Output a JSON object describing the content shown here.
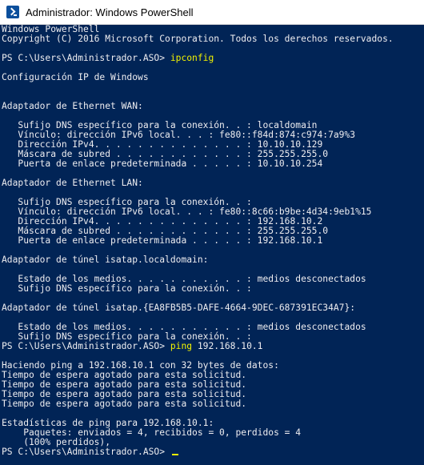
{
  "window": {
    "title": "Administrador: Windows PowerShell"
  },
  "console": {
    "l1": "Windows PowerShell",
    "l2": "Copyright (C) 2016 Microsoft Corporation. Todos los derechos reservados.",
    "prompt": "PS C:\\Users\\Administrador.ASO> ",
    "cmd1": "ipconfig",
    "l5": "Configuración IP de Windows",
    "l8": "Adaptador de Ethernet WAN:",
    "l10": "   Sufijo DNS específico para la conexión. . : localdomain",
    "l11": "   Vínculo: dirección IPv6 local. . . : fe80::f84d:874:c974:7a9%3",
    "l12": "   Dirección IPv4. . . . . . . . . . . . . . : 10.10.10.129",
    "l13": "   Máscara de subred . . . . . . . . . . . . : 255.255.255.0",
    "l14": "   Puerta de enlace predeterminada . . . . . : 10.10.10.254",
    "l16": "Adaptador de Ethernet LAN:",
    "l18": "   Sufijo DNS específico para la conexión. . :",
    "l19": "   Vínculo: dirección IPv6 local. . . : fe80::8c66:b9be:4d34:9eb1%15",
    "l20": "   Dirección IPv4. . . . . . . . . . . . . . : 192.168.10.2",
    "l21": "   Máscara de subred . . . . . . . . . . . . : 255.255.255.0",
    "l22": "   Puerta de enlace predeterminada . . . . . : 192.168.10.1",
    "l24": "Adaptador de túnel isatap.localdomain:",
    "l26": "   Estado de los medios. . . . . . . . . . . : medios desconectados",
    "l27": "   Sufijo DNS específico para la conexión. . :",
    "l29": "Adaptador de túnel isatap.{EA8FB5B5-DAFE-4664-9DEC-687391EC34A7}:",
    "l31": "   Estado de los medios. . . . . . . . . . . : medios desconectados",
    "l32": "   Sufijo DNS específico para la conexión. . :",
    "cmd2": "ping",
    "cmd2_arg": " 192.168.10.1",
    "l35": "Haciendo ping a 192.168.10.1 con 32 bytes de datos:",
    "l36": "Tiempo de espera agotado para esta solicitud.",
    "l37": "Tiempo de espera agotado para esta solicitud.",
    "l38": "Tiempo de espera agotado para esta solicitud.",
    "l39": "Tiempo de espera agotado para esta solicitud.",
    "l41": "Estadísticas de ping para 192.168.10.1:",
    "l42": "    Paquetes: enviados = 4, recibidos = 0, perdidos = 4",
    "l43": "    (100% perdidos),"
  },
  "colors": {
    "background": "#012456",
    "text": "#eeedf0",
    "command": "#f2f200"
  }
}
